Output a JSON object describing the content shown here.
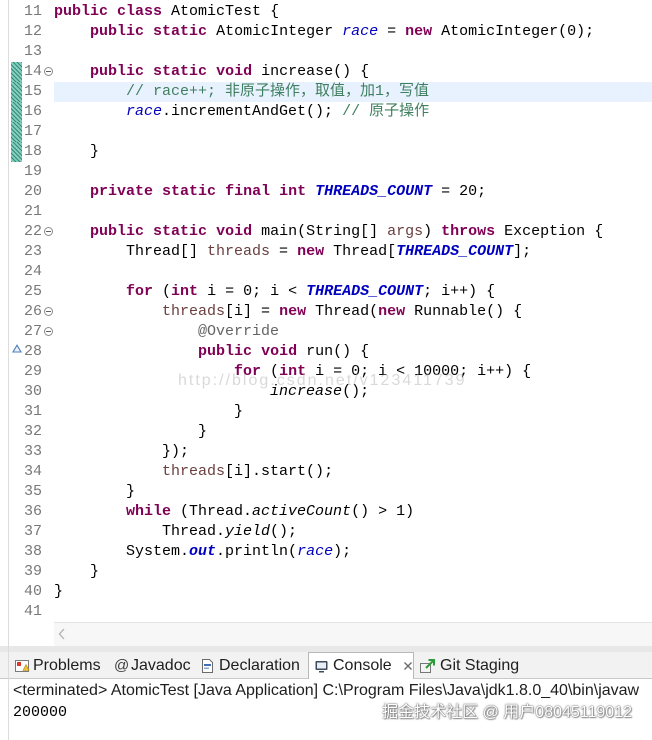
{
  "editor": {
    "syntax_colors": {
      "keyword": "#7F0055",
      "field": "#0000C0",
      "constant": "#0000C0",
      "comment": "#3F7F5F",
      "annotation": "#646464",
      "local": "#6A3E3E",
      "current_line": "#E8F2FE"
    },
    "lines": [
      {
        "num": 11,
        "tokens": [
          {
            "keyword": "public"
          },
          {
            "plain": " "
          },
          {
            "keyword": "class"
          },
          {
            "plain": " AtomicTest {"
          }
        ]
      },
      {
        "num": 12,
        "tokens": [
          {
            "plain": "    "
          },
          {
            "keyword": "public"
          },
          {
            "plain": " "
          },
          {
            "keyword": "static"
          },
          {
            "plain": " AtomicInteger "
          },
          {
            "field": "race"
          },
          {
            "plain": " = "
          },
          {
            "keyword": "new"
          },
          {
            "plain": " AtomicInteger(0);"
          }
        ]
      },
      {
        "num": 13,
        "tokens": []
      },
      {
        "num": 14,
        "fold": true,
        "changed": true,
        "tokens": [
          {
            "plain": "    "
          },
          {
            "keyword": "public"
          },
          {
            "plain": " "
          },
          {
            "keyword": "static"
          },
          {
            "plain": " "
          },
          {
            "keyword": "void"
          },
          {
            "plain": " increase() {"
          }
        ]
      },
      {
        "num": 15,
        "changed": true,
        "current": true,
        "tokens": [
          {
            "plain": "        "
          },
          {
            "comment": "// race++; 非原子操作，取值，加1，写值"
          }
        ]
      },
      {
        "num": 16,
        "changed": true,
        "tokens": [
          {
            "plain": "        "
          },
          {
            "field": "race"
          },
          {
            "plain": ".incrementAndGet(); "
          },
          {
            "comment": "// 原子操作"
          }
        ]
      },
      {
        "num": 17,
        "changed": true,
        "tokens": []
      },
      {
        "num": 18,
        "changed": true,
        "tokens": [
          {
            "plain": "    }"
          }
        ]
      },
      {
        "num": 19,
        "tokens": []
      },
      {
        "num": 20,
        "tokens": [
          {
            "plain": "    "
          },
          {
            "keyword": "private"
          },
          {
            "plain": " "
          },
          {
            "keyword": "static"
          },
          {
            "plain": " "
          },
          {
            "keyword": "final"
          },
          {
            "plain": " "
          },
          {
            "keyword": "int"
          },
          {
            "plain": " "
          },
          {
            "constant": "THREADS_COUNT"
          },
          {
            "plain": " = 20;"
          }
        ]
      },
      {
        "num": 21,
        "tokens": []
      },
      {
        "num": 22,
        "fold": true,
        "tokens": [
          {
            "plain": "    "
          },
          {
            "keyword": "public"
          },
          {
            "plain": " "
          },
          {
            "keyword": "static"
          },
          {
            "plain": " "
          },
          {
            "keyword": "void"
          },
          {
            "plain": " main(String[] "
          },
          {
            "local": "args"
          },
          {
            "plain": ") "
          },
          {
            "keyword": "throws"
          },
          {
            "plain": " Exception {"
          }
        ]
      },
      {
        "num": 23,
        "tokens": [
          {
            "plain": "        Thread[] "
          },
          {
            "local": "threads"
          },
          {
            "plain": " = "
          },
          {
            "keyword": "new"
          },
          {
            "plain": " Thread["
          },
          {
            "constant": "THREADS_COUNT"
          },
          {
            "plain": "];"
          }
        ]
      },
      {
        "num": 24,
        "tokens": []
      },
      {
        "num": 25,
        "tokens": [
          {
            "plain": "        "
          },
          {
            "keyword": "for"
          },
          {
            "plain": " ("
          },
          {
            "keyword": "int"
          },
          {
            "plain": " i = 0; i < "
          },
          {
            "constant": "THREADS_COUNT"
          },
          {
            "plain": "; i++) {"
          }
        ]
      },
      {
        "num": 26,
        "fold": true,
        "tokens": [
          {
            "plain": "            "
          },
          {
            "local": "threads"
          },
          {
            "plain": "[i] = "
          },
          {
            "keyword": "new"
          },
          {
            "plain": " Thread("
          },
          {
            "keyword": "new"
          },
          {
            "plain": " Runnable() {"
          }
        ]
      },
      {
        "num": 27,
        "fold": true,
        "tokens": [
          {
            "plain": "                "
          },
          {
            "annotation": "@Override"
          }
        ]
      },
      {
        "num": 28,
        "override": true,
        "tokens": [
          {
            "plain": "                "
          },
          {
            "keyword": "public"
          },
          {
            "plain": " "
          },
          {
            "keyword": "void"
          },
          {
            "plain": " run() {"
          }
        ]
      },
      {
        "num": 29,
        "tokens": [
          {
            "plain": "                    "
          },
          {
            "keyword": "for"
          },
          {
            "plain": " ("
          },
          {
            "keyword": "int"
          },
          {
            "plain": " i = 0; i < 10000; i++) {"
          }
        ]
      },
      {
        "num": 30,
        "tokens": [
          {
            "plain": "                        "
          },
          {
            "static-method": "increase"
          },
          {
            "plain": "();"
          }
        ]
      },
      {
        "num": 31,
        "tokens": [
          {
            "plain": "                    }"
          }
        ]
      },
      {
        "num": 32,
        "tokens": [
          {
            "plain": "                }"
          }
        ]
      },
      {
        "num": 33,
        "tokens": [
          {
            "plain": "            });"
          }
        ]
      },
      {
        "num": 34,
        "tokens": [
          {
            "plain": "            "
          },
          {
            "local": "threads"
          },
          {
            "plain": "[i].start();"
          }
        ]
      },
      {
        "num": 35,
        "tokens": [
          {
            "plain": "        }"
          }
        ]
      },
      {
        "num": 36,
        "tokens": [
          {
            "plain": "        "
          },
          {
            "keyword": "while"
          },
          {
            "plain": " (Thread."
          },
          {
            "static-method": "activeCount"
          },
          {
            "plain": "() > 1)"
          }
        ]
      },
      {
        "num": 37,
        "tokens": [
          {
            "plain": "            Thread."
          },
          {
            "static-method": "yield"
          },
          {
            "plain": "();"
          }
        ]
      },
      {
        "num": 38,
        "tokens": [
          {
            "plain": "        System."
          },
          {
            "constant": "out"
          },
          {
            "plain": ".println("
          },
          {
            "field": "race"
          },
          {
            "plain": ");"
          }
        ]
      },
      {
        "num": 39,
        "tokens": [
          {
            "plain": "    }"
          }
        ]
      },
      {
        "num": 40,
        "tokens": [
          {
            "plain": "}"
          }
        ]
      },
      {
        "num": 41,
        "tokens": []
      }
    ],
    "watermark": "http://blog.csdn.net/v123411739"
  },
  "panel": {
    "tabs": [
      {
        "label": "Problems",
        "icon": "problems-icon"
      },
      {
        "label": "Javadoc",
        "icon": "at-sign-icon"
      },
      {
        "label": "Declaration",
        "icon": "declaration-icon"
      },
      {
        "label": "Console",
        "icon": "console-icon",
        "active": true,
        "closable": true
      },
      {
        "label": "Git Staging",
        "icon": "git-staging-icon"
      }
    ],
    "console": {
      "header": "<terminated> AtomicTest [Java Application] C:\\Program Files\\Java\\jdk1.8.0_40\\bin\\javaw",
      "output": [
        "200000"
      ]
    }
  },
  "watermark": "掘金技术社区 @ 用户08045119012"
}
